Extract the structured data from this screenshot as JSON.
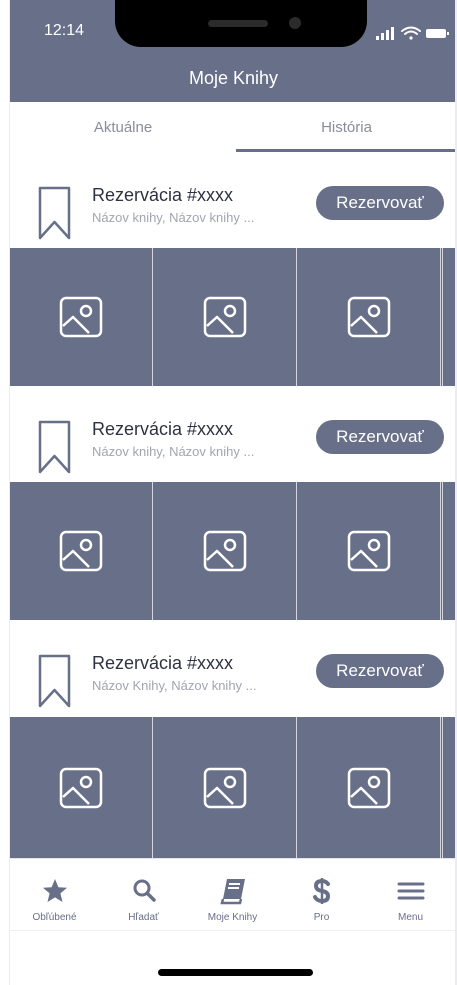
{
  "status": {
    "time": "12:14"
  },
  "header": {
    "title": "Moje Knihy"
  },
  "tabs": [
    {
      "label": "Aktuálne",
      "active": false
    },
    {
      "label": "História",
      "active": true
    }
  ],
  "reservations": [
    {
      "title": "Rezervácia #xxxx",
      "subtitle": "Názov knihy, Názov knihy ...",
      "button": "Rezervovať"
    },
    {
      "title": "Rezervácia #xxxx",
      "subtitle": "Názov knihy, Názov knihy ...",
      "button": "Rezervovať"
    },
    {
      "title": "Rezervácia #xxxx",
      "subtitle": "Názov Knihy, Názov knihy ...",
      "button": "Rezervovať"
    }
  ],
  "tabbar": [
    {
      "label": "Obľúbené",
      "icon": "star-icon"
    },
    {
      "label": "Hľadať",
      "icon": "search-icon"
    },
    {
      "label": "Moje Knihy",
      "icon": "book-icon"
    },
    {
      "label": "Pro",
      "icon": "dollar-icon"
    },
    {
      "label": "Menu",
      "icon": "menu-icon"
    }
  ],
  "colors": {
    "accent": "#686f88",
    "background": "#ffffff",
    "divider": "#d4d6de"
  }
}
